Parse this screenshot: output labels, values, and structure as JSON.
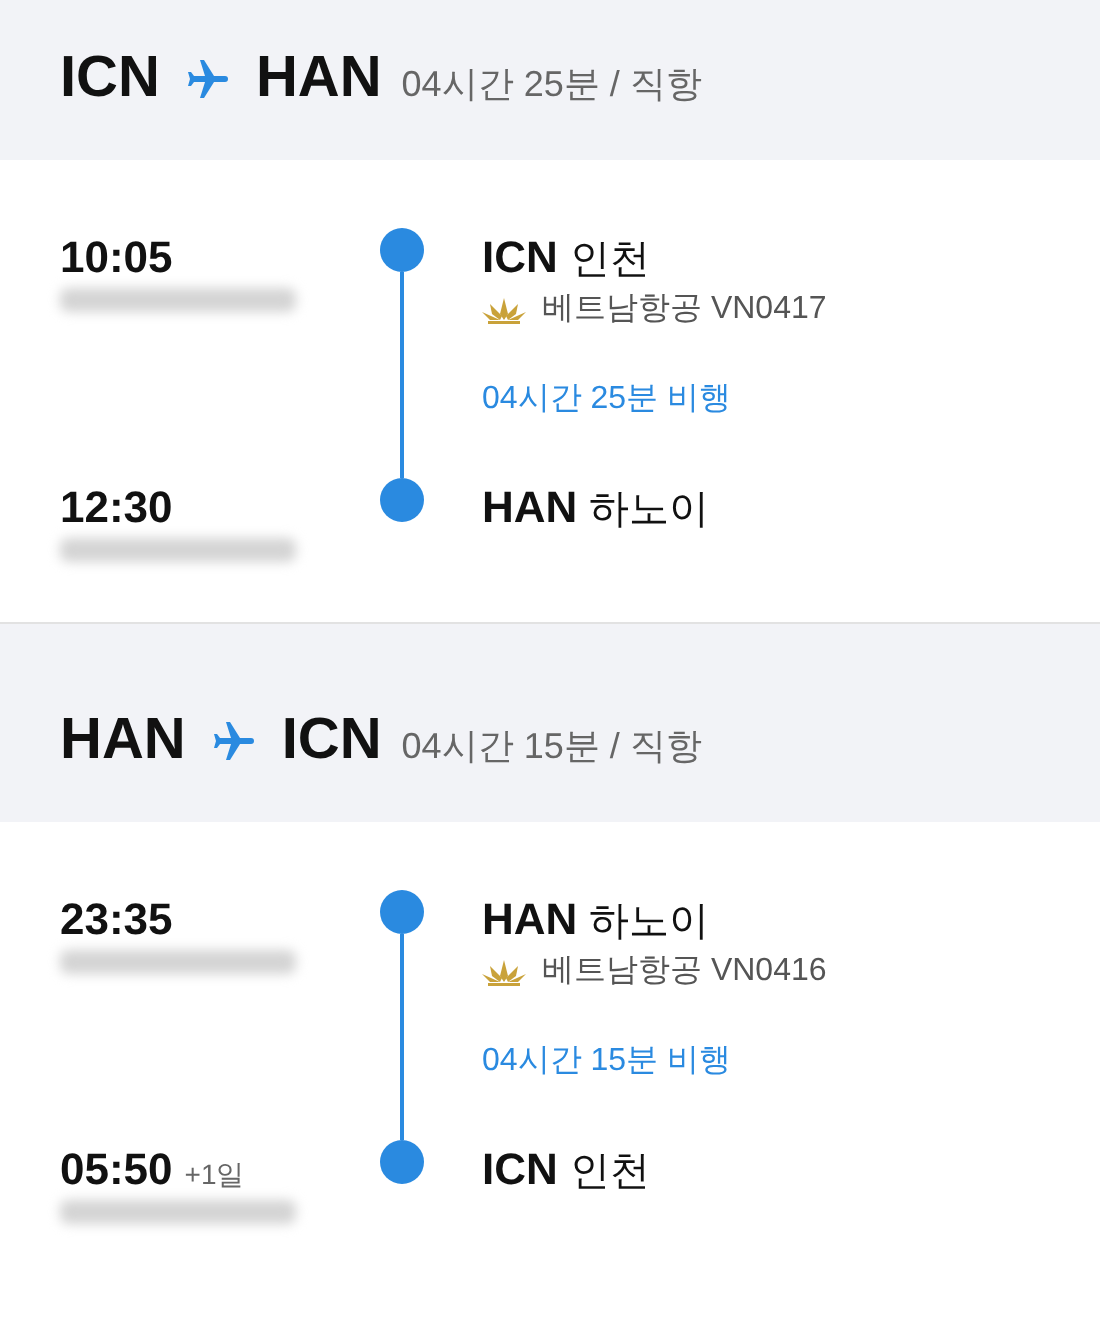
{
  "flights": [
    {
      "route": {
        "from": "ICN",
        "to": "HAN"
      },
      "summary": "04시간 25분 / 직항",
      "departure": {
        "time": "10:05",
        "code": "ICN",
        "city": "인천"
      },
      "airline": {
        "name": "베트남항공",
        "flight_no": "VN0417"
      },
      "flight_time": "04시간 25분 비행",
      "arrival": {
        "time": "12:30",
        "code": "HAN",
        "city": "하노이"
      }
    },
    {
      "route": {
        "from": "HAN",
        "to": "ICN"
      },
      "summary": "04시간 15분 / 직항",
      "departure": {
        "time": "23:35",
        "code": "HAN",
        "city": "하노이"
      },
      "airline": {
        "name": "베트남항공",
        "flight_no": "VN0416"
      },
      "flight_time": "04시간 15분 비행",
      "arrival": {
        "time": "05:50",
        "day_offset": "+1일",
        "code": "ICN",
        "city": "인천"
      }
    }
  ]
}
